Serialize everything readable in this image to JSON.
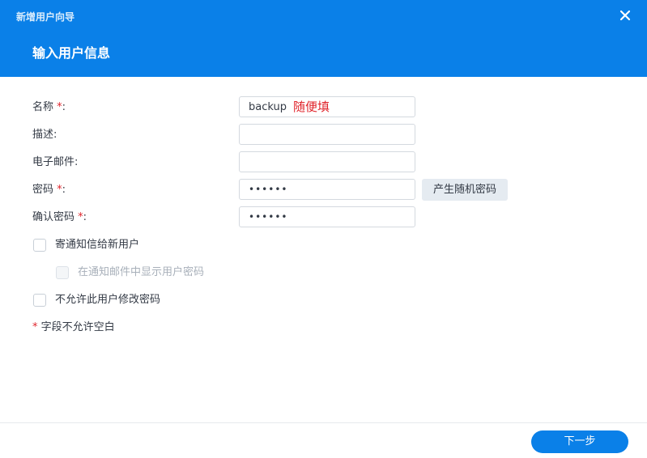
{
  "dialog": {
    "window_title": "新增用户向导",
    "step_title": "输入用户信息",
    "close_icon": "close-icon"
  },
  "form": {
    "name_label": "名称",
    "desc_label": "描述:",
    "email_label": "电子邮件:",
    "password_label": "密码",
    "confirm_label": "确认密码",
    "required_mark": "*",
    "colon": ":",
    "name_value": "backup",
    "name_hint": "随便填",
    "desc_value": "",
    "email_value": "",
    "password_mask": "••••••",
    "confirm_mask": "••••••",
    "generate_password_button": "产生随机密码"
  },
  "options": {
    "send_notification": {
      "label": "寄通知信给新用户",
      "checked": false
    },
    "show_password_in_email": {
      "label": "在通知邮件中显示用户密码",
      "checked": false,
      "disabled": true
    },
    "disallow_password_change": {
      "label": "不允许此用户修改密码",
      "checked": false
    }
  },
  "note": {
    "mark": "*",
    "text": "字段不允许空白"
  },
  "footer": {
    "next_button": "下一步"
  },
  "colors": {
    "accent": "#0a80e8",
    "required": "#e0252c"
  }
}
